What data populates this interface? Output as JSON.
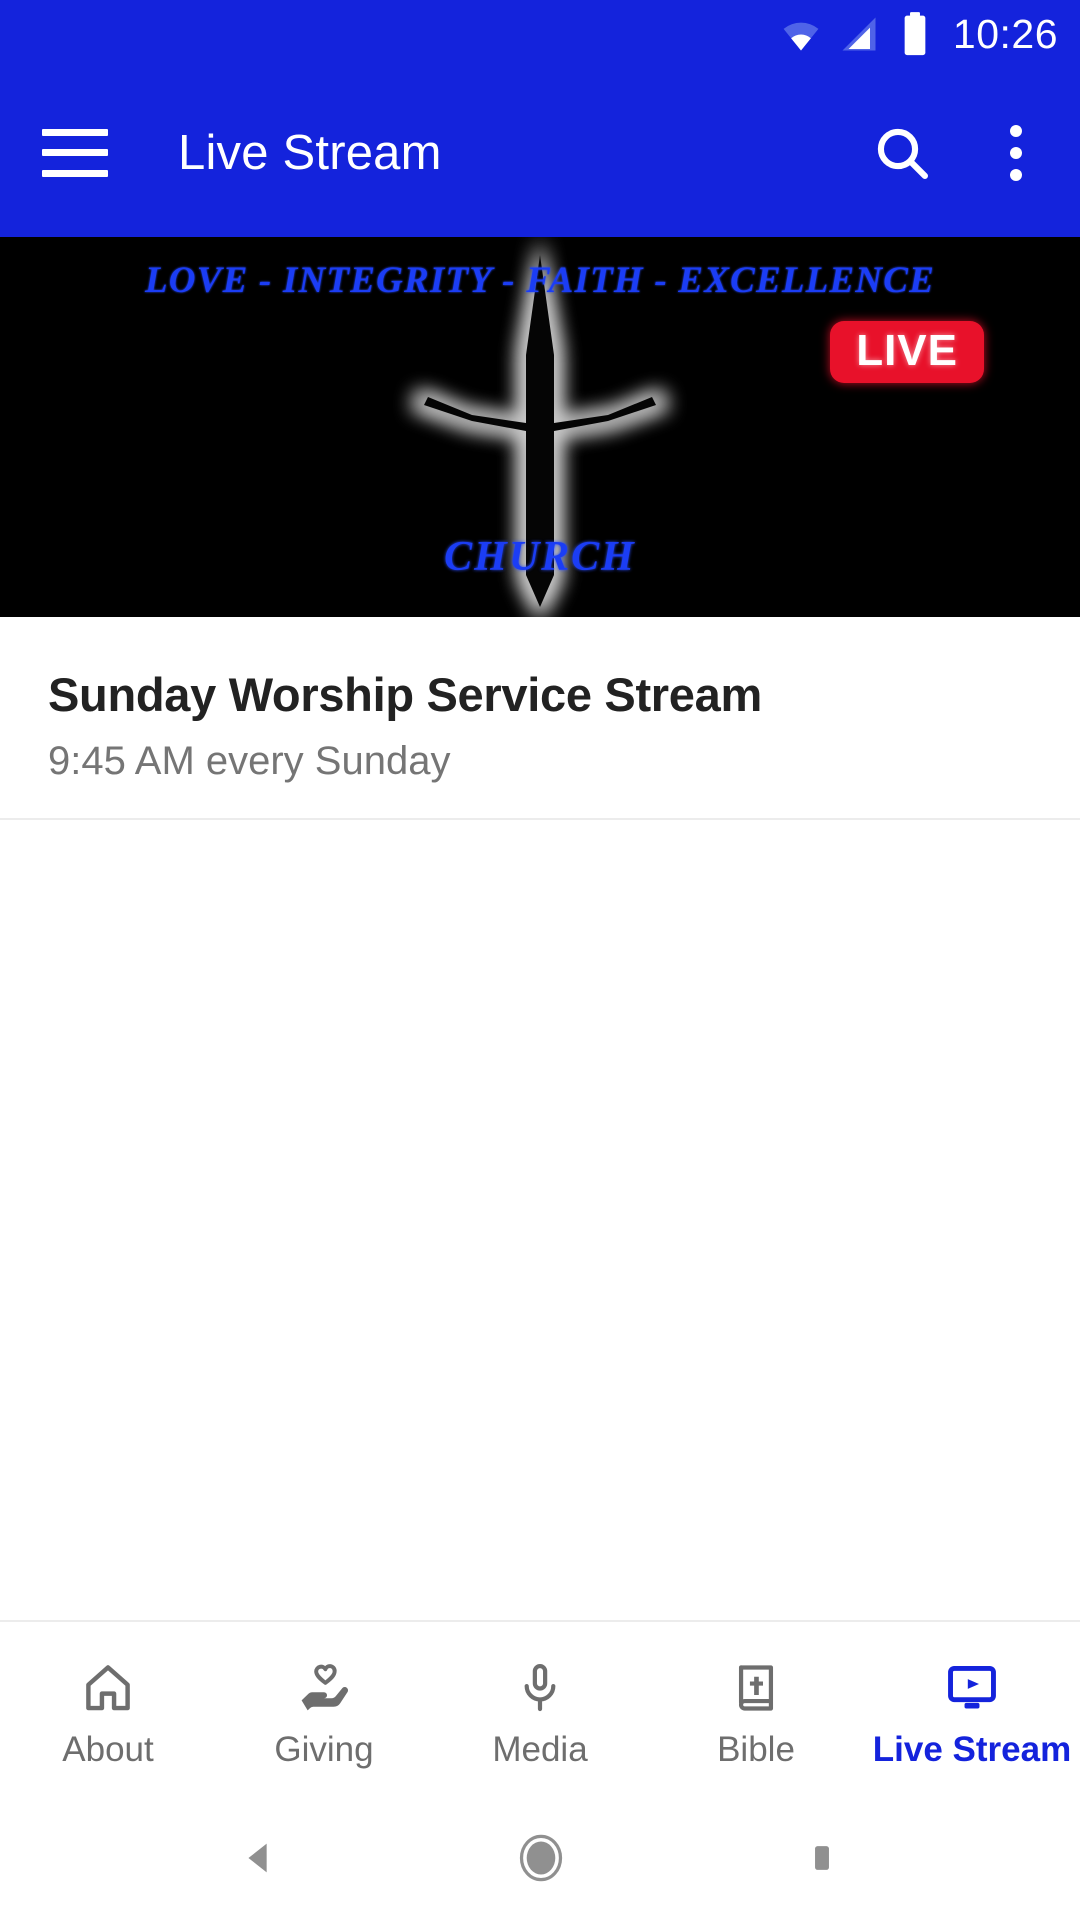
{
  "statusbar": {
    "time": "10:26",
    "icons": [
      "wifi-icon",
      "cellular-signal-icon",
      "battery-icon"
    ]
  },
  "appbar": {
    "menu_icon": "hamburger-menu-icon",
    "title": "Live Stream",
    "search_icon": "search-icon",
    "overflow_icon": "more-vertical-icon",
    "background_color": "#1423DC"
  },
  "player": {
    "poster_alt": "church-logo-poster",
    "background_color": "#000000",
    "logo": {
      "tagline": "LOVE - INTEGRITY - FAITH - EXCELLENCE",
      "word": "CHURCH",
      "text_color": "#1b3df5",
      "cross_icon": "glowing-cross-icon"
    },
    "live_badge": {
      "label": "LIVE",
      "background_color": "#e8112a",
      "text_color": "#ffffff"
    }
  },
  "stream_info": {
    "title": "Sunday Worship Service Stream",
    "subtitle": "9:45 AM every Sunday"
  },
  "bottom_nav": {
    "active_color": "#1423DC",
    "inactive_color": "#6e6e6e",
    "items": [
      {
        "label": "About",
        "icon": "home-icon",
        "active": false
      },
      {
        "label": "Giving",
        "icon": "hand-heart-icon",
        "active": false
      },
      {
        "label": "Media",
        "icon": "microphone-icon",
        "active": false
      },
      {
        "label": "Bible",
        "icon": "book-cross-icon",
        "active": false
      },
      {
        "label": "Live Stream",
        "icon": "monitor-play-icon",
        "active": true
      }
    ]
  },
  "system_nav": {
    "back": "back-triangle-icon",
    "home": "home-circle-icon",
    "recents": "recents-square-icon"
  }
}
